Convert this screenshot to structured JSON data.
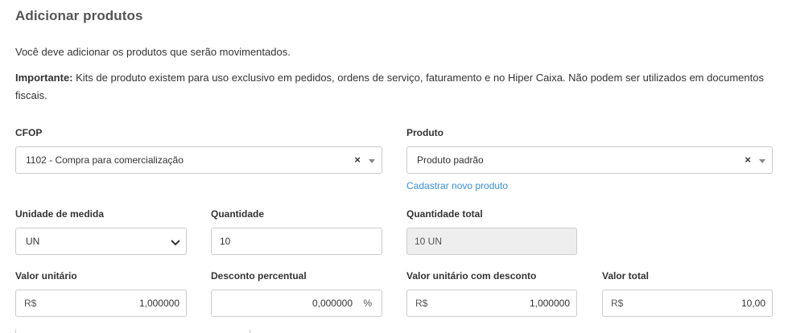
{
  "header": {
    "title": "Adicionar produtos"
  },
  "intro": {
    "text": "Você deve adicionar os produtos que serão movimentados.",
    "important_label": "Importante:",
    "important_text": " Kits de produto existem para uso exclusivo em pedidos, ordens de serviço, faturamento e no Hiper Caixa. Não podem ser utilizados em documentos fiscais."
  },
  "form": {
    "cfop": {
      "label": "CFOP",
      "value": "1102 - Compra para comercialização",
      "clear_icon": "×"
    },
    "produto": {
      "label": "Produto",
      "value": "Produto padrão",
      "clear_icon": "×",
      "link": "Cadastrar novo produto"
    },
    "unidade": {
      "label": "Unidade de medida",
      "value": "UN"
    },
    "quantidade": {
      "label": "Quantidade",
      "value": "10"
    },
    "quantidade_total": {
      "label": "Quantidade total",
      "value": "10 UN"
    },
    "valor_unitario": {
      "label": "Valor unitário",
      "prefix": "R$",
      "value": "1,000000"
    },
    "desconto": {
      "label": "Desconto percentual",
      "value": "0,000000",
      "suffix": "%"
    },
    "valor_desconto": {
      "label": "Valor unitário com desconto",
      "prefix": "R$",
      "value": "1,000000"
    },
    "valor_total": {
      "label": "Valor total",
      "prefix": "R$",
      "value": "10,00"
    }
  },
  "colors": {
    "link": "#3a8fd9",
    "border": "#cccccc",
    "disabled_bg": "#eeeeee"
  }
}
